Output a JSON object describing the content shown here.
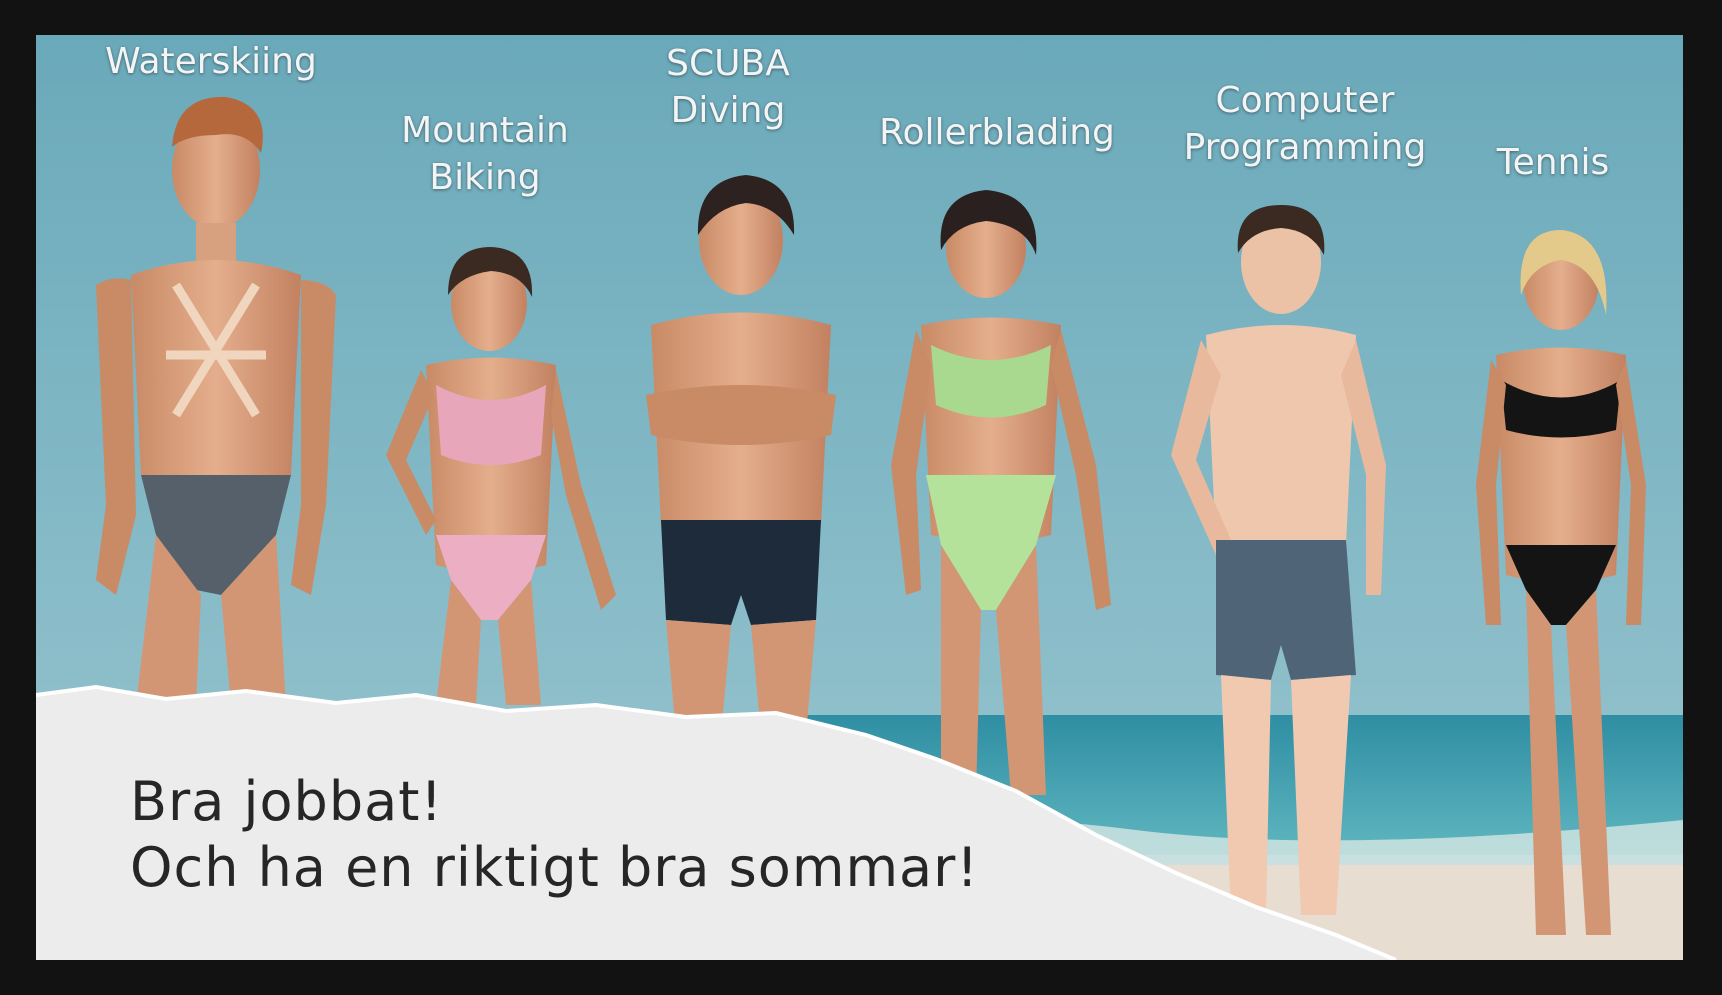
{
  "labels": {
    "waterskiing": [
      "Waterskiing"
    ],
    "mountain_biking": [
      "Mountain",
      "Biking"
    ],
    "scuba_diving": [
      "SCUBA",
      "Diving"
    ],
    "rollerblading": [
      "Rollerblading"
    ],
    "computer_programming": [
      "Computer",
      "Programming"
    ],
    "tennis": [
      "Tennis"
    ]
  },
  "caption": {
    "line1": "Bra jobbat!",
    "line2": "Och ha en riktigt bra sommar!"
  },
  "colors": {
    "sky": "#7fb6c4",
    "sea": "#3f9fb0",
    "skin": "#d9a07e",
    "torn_paper": "#ececec",
    "frame": "#121212"
  }
}
